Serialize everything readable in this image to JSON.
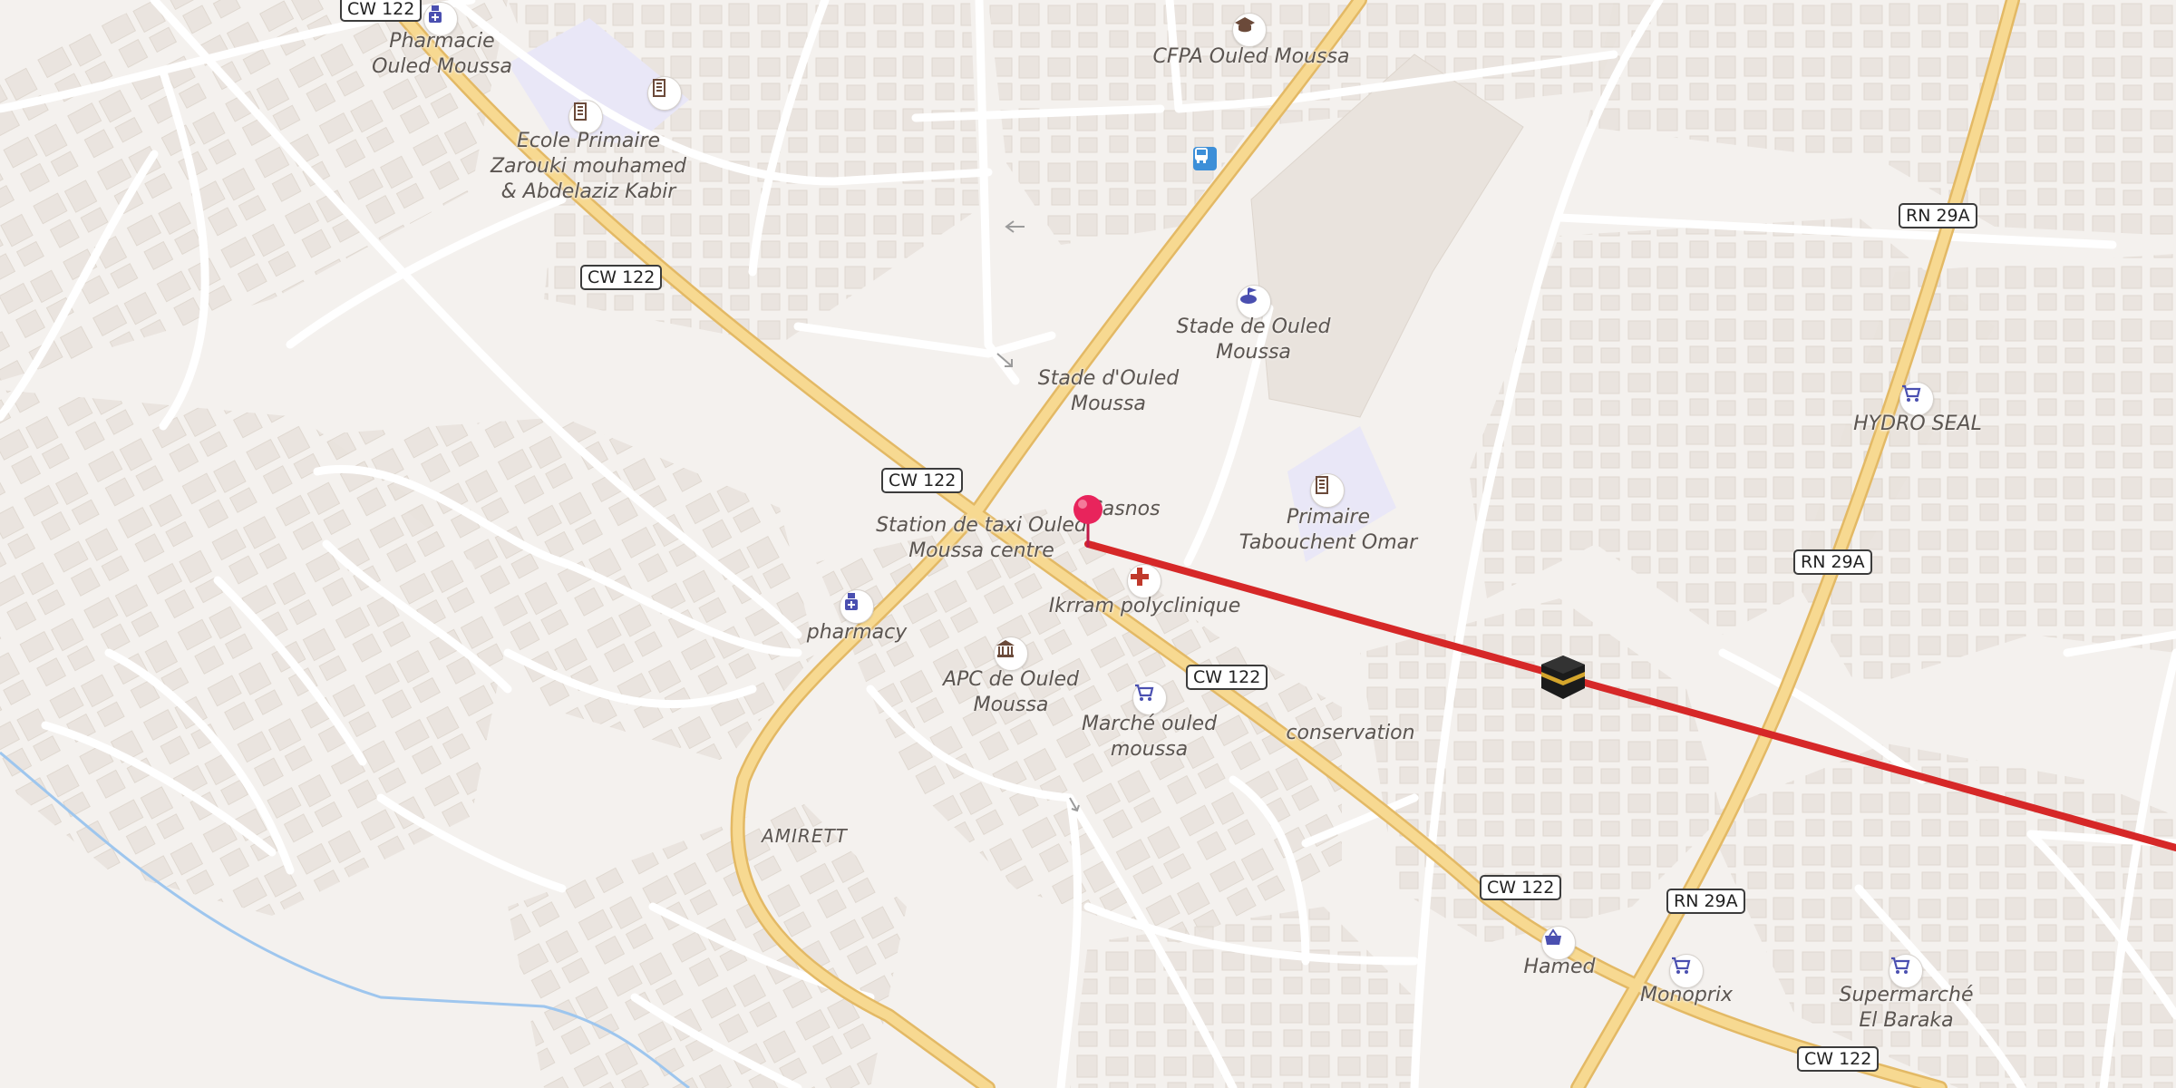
{
  "map": {
    "area_label": "AMIRETT",
    "road_shields": [
      {
        "id": "cw122-a",
        "text": "CW 122"
      },
      {
        "id": "cw122-b",
        "text": "CW 122"
      },
      {
        "id": "cw122-c",
        "text": "CW 122"
      },
      {
        "id": "cw122-d",
        "text": "CW 122"
      },
      {
        "id": "cw122-e",
        "text": "CW 122"
      },
      {
        "id": "cw122-f",
        "text": "CW 122"
      },
      {
        "id": "rn29a-a",
        "text": "RN 29A"
      },
      {
        "id": "rn29a-b",
        "text": "RN 29A"
      },
      {
        "id": "rn29a-c",
        "text": "RN 29A"
      }
    ],
    "places": [
      {
        "name": "Pharmacie\nOuled Moussa",
        "icon": "pharmacy-icon"
      },
      {
        "name": "Ecole Primaire\nZarouki mouhamed\n& Abdelaziz Kabir",
        "icon": "school-icon"
      },
      {
        "name": "CFPA Ouled Moussa",
        "icon": "graduation-cap-icon"
      },
      {
        "name": "Stade de Ouled\nMoussa",
        "icon": "stadium-icon"
      },
      {
        "name": "Stade d'Ouled\nMoussa",
        "icon": ""
      },
      {
        "name": "HYDRO SEAL",
        "icon": "shopping-cart-icon"
      },
      {
        "name": "Station de taxi Ouled\nMoussa centre",
        "icon": ""
      },
      {
        "name": "Casnos",
        "icon": ""
      },
      {
        "name": "Primaire\nTabouchent Omar",
        "icon": "school-icon"
      },
      {
        "name": "Ikrram polyclinique",
        "icon": "medical-cross-icon"
      },
      {
        "name": "pharmacy",
        "icon": "pharmacy-icon"
      },
      {
        "name": "APC de Ouled\nMoussa",
        "icon": "town-hall-icon"
      },
      {
        "name": "Marché ouled\nmoussa",
        "icon": "shopping-cart-icon"
      },
      {
        "name": "conservation",
        "icon": ""
      },
      {
        "name": "Hamed",
        "icon": "shopping-basket-icon"
      },
      {
        "name": "Monoprix",
        "icon": "shopping-cart-icon"
      },
      {
        "name": "Supermarché\nEl Baraka",
        "icon": "shopping-cart-icon"
      }
    ],
    "markers": {
      "location_pin": {
        "icon": "map-pin-icon",
        "color": "#e8245c"
      },
      "qibla_line": {
        "color": "#d62828",
        "destination_icon": "kaaba-icon"
      }
    },
    "colors": {
      "background": "#f4f1ee",
      "building": "#e9e3dd",
      "minor_road": "#ffffff",
      "major_road": "#f7d991",
      "major_road_casing": "#e3b965",
      "water": "#9ec6ee",
      "poi_icon": "#4a4fb0"
    }
  }
}
